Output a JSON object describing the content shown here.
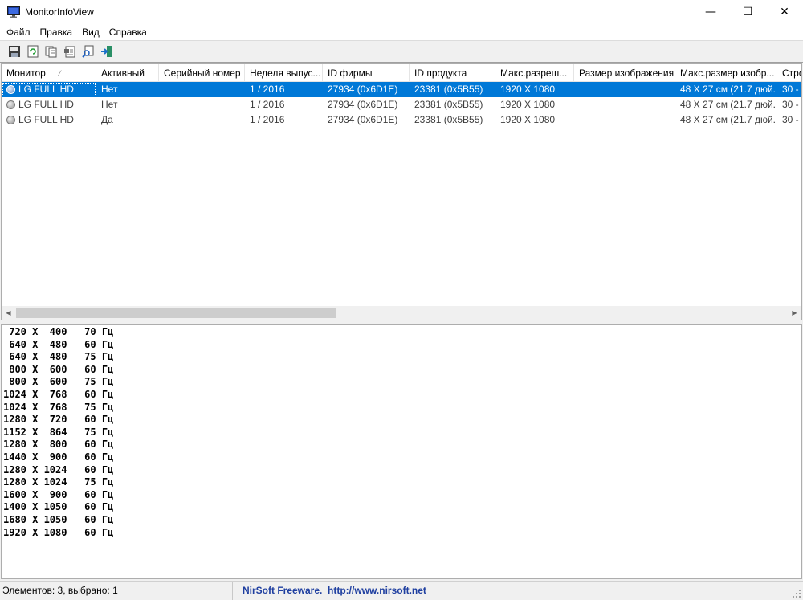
{
  "window": {
    "title": "MonitorInfoView",
    "controls": {
      "minimize": "—",
      "maximize": "☐",
      "close": "✕"
    }
  },
  "menu": [
    "Файл",
    "Правка",
    "Вид",
    "Справка"
  ],
  "toolbar": [
    {
      "name": "save-icon"
    },
    {
      "name": "refresh-icon"
    },
    {
      "name": "copy-icon"
    },
    {
      "name": "properties-icon"
    },
    {
      "name": "find-icon"
    },
    {
      "name": "exit-icon"
    }
  ],
  "table": {
    "sorted_column": "Монитор",
    "sort_indicator": "⁄",
    "columns": [
      "Монитор",
      "Активный",
      "Серийный номер",
      "Неделя выпус...",
      "ID фирмы",
      "ID продукта",
      "Макс.разреш...",
      "Размер изображения",
      "Макс.размер изобр...",
      "Стро"
    ],
    "rows": [
      {
        "selected": true,
        "cells": [
          "LG FULL HD",
          "Нет",
          "",
          "1 / 2016",
          "27934 (0x6D1E)",
          "23381 (0x5B55)",
          "1920 X 1080",
          "",
          "48 X 27 см (21.7 дюй...",
          "30 - "
        ]
      },
      {
        "selected": false,
        "cells": [
          "LG FULL HD",
          "Нет",
          "",
          "1 / 2016",
          "27934 (0x6D1E)",
          "23381 (0x5B55)",
          "1920 X 1080",
          "",
          "48 X 27 см (21.7 дюй...",
          "30 - "
        ]
      },
      {
        "selected": false,
        "cells": [
          "LG FULL HD",
          "Да",
          "",
          "1 / 2016",
          "27934 (0x6D1E)",
          "23381 (0x5B55)",
          "1920 X 1080",
          "",
          "48 X 27 см (21.7 дюй...",
          "30 - "
        ]
      }
    ]
  },
  "scrollbar": {
    "left_arrow": "◀",
    "right_arrow": "▶"
  },
  "modes": [
    " 720 X  400   70 Гц",
    " 640 X  480   60 Гц",
    " 640 X  480   75 Гц",
    " 800 X  600   60 Гц",
    " 800 X  600   75 Гц",
    "1024 X  768   60 Гц",
    "1024 X  768   75 Гц",
    "1280 X  720   60 Гц",
    "1152 X  864   75 Гц",
    "1280 X  800   60 Гц",
    "1440 X  900   60 Гц",
    "1280 X 1024   60 Гц",
    "1280 X 1024   75 Гц",
    "1600 X  900   60 Гц",
    "1400 X 1050   60 Гц",
    "1680 X 1050   60 Гц",
    "1920 X 1080   60 Гц"
  ],
  "status": {
    "count_text": "Элементов: 3, выбрано: 1",
    "link_text": "NirSoft Freeware.  http://www.nirsoft.net"
  },
  "colors": {
    "selection": "#0078d7",
    "link": "#1f3fa0"
  }
}
